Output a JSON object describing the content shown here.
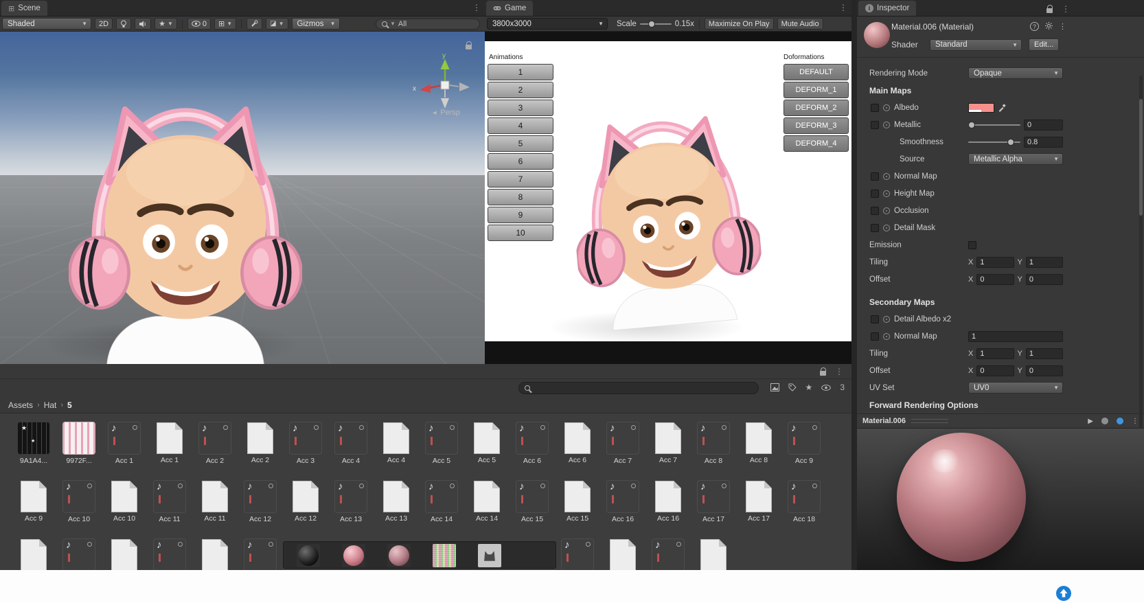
{
  "scene_view": {
    "tab_label": "Scene",
    "toolbar": {
      "draw_mode": "Shaded",
      "mode_2d_label": "2D",
      "visibility_count": "0",
      "gizmos_label": "Gizmos",
      "search_value": "All"
    },
    "gizmo": {
      "persp_label": "Persp",
      "axis_x_label": "x",
      "axis_y_label": "y"
    }
  },
  "game_view": {
    "tab_label": "Game",
    "toolbar": {
      "resolution": "3800x3000",
      "scale_label": "Scale",
      "scale_value": "0.15x",
      "maximize_label": "Maximize On Play",
      "mute_label": "Mute Audio"
    },
    "animations_title": "Animations",
    "animation_buttons": [
      "1",
      "2",
      "3",
      "4",
      "5",
      "6",
      "7",
      "8",
      "9",
      "10"
    ],
    "deformations_title": "Doformations",
    "deformation_buttons": [
      "DEFAULT",
      "DEFORM_1",
      "DEFORM_2",
      "DEFORM_3",
      "DEFORM_4"
    ]
  },
  "inspector": {
    "tab_label": "Inspector",
    "header": {
      "title": "Material.006 (Material)",
      "shader_label": "Shader",
      "shader_value": "Standard",
      "edit_button": "Edit..."
    },
    "rendering_mode": {
      "label": "Rendering Mode",
      "value": "Opaque"
    },
    "axis_labels": {
      "x": "X",
      "y": "Y"
    },
    "main_maps": {
      "section_label": "Main Maps",
      "albedo_label": "Albedo",
      "albedo_color": "#f5908c",
      "metallic_label": "Metallic",
      "metallic_value": "0",
      "smoothness_label": "Smoothness",
      "smoothness_value": "0.8",
      "source_label": "Source",
      "source_value": "Metallic Alpha",
      "normal_map_label": "Normal Map",
      "height_map_label": "Height Map",
      "occlusion_label": "Occlusion",
      "detail_mask_label": "Detail Mask",
      "emission_label": "Emission",
      "tiling_label": "Tiling",
      "offset_label": "Offset",
      "tiling_x": "1",
      "tiling_y": "1",
      "offset_x": "0",
      "offset_y": "0"
    },
    "secondary_maps": {
      "section_label": "Secondary Maps",
      "detail_albedo_label": "Detail Albedo x2",
      "normal_map_label": "Normal Map",
      "normal_map_value": "1",
      "tiling_label": "Tiling",
      "offset_label": "Offset",
      "tiling_x": "1",
      "tiling_y": "1",
      "offset_x": "0",
      "offset_y": "0",
      "uv_set_label": "UV Set",
      "uv_set_value": "UV0"
    },
    "forward_rendering_label": "Forward Rendering Options",
    "preview": {
      "title": "Material.006"
    }
  },
  "project": {
    "breadcrumb": {
      "root": "Assets",
      "folder": "Hat",
      "leaf": "5"
    },
    "hidden_count": "3",
    "asset_rows": [
      {
        "items": [
          {
            "label": "9A1A4...",
            "type": "tex-dark"
          },
          {
            "label": "9972F...",
            "type": "tex-pink"
          },
          {
            "label": "Acc 1",
            "type": "audio"
          },
          {
            "label": "Acc 1",
            "type": "doc"
          },
          {
            "label": "Acc 2",
            "type": "audio"
          },
          {
            "label": "Acc 2",
            "type": "doc"
          },
          {
            "label": "Acc 3",
            "type": "audio"
          },
          {
            "label": "Acc 4",
            "type": "audio"
          },
          {
            "label": "Acc 4",
            "type": "doc"
          },
          {
            "label": "Acc 5",
            "type": "audio"
          },
          {
            "label": "Acc 5",
            "type": "doc"
          },
          {
            "label": "Acc 6",
            "type": "audio"
          },
          {
            "label": "Acc 6",
            "type": "doc"
          },
          {
            "label": "Acc 7",
            "type": "audio"
          },
          {
            "label": "Acc 7",
            "type": "doc"
          },
          {
            "label": "Acc 8",
            "type": "audio"
          },
          {
            "label": "Acc 8",
            "type": "doc"
          },
          {
            "label": "Acc 9",
            "type": "audio"
          }
        ]
      },
      {
        "items": [
          {
            "label": "Acc 9",
            "type": "doc"
          },
          {
            "label": "Acc 10",
            "type": "audio"
          },
          {
            "label": "Acc 10",
            "type": "doc"
          },
          {
            "label": "Acc 11",
            "type": "audio"
          },
          {
            "label": "Acc 11",
            "type": "doc"
          },
          {
            "label": "Acc 12",
            "type": "audio"
          },
          {
            "label": "Acc 12",
            "type": "doc"
          },
          {
            "label": "Acc 13",
            "type": "audio"
          },
          {
            "label": "Acc 13",
            "type": "doc"
          },
          {
            "label": "Acc 14",
            "type": "audio"
          },
          {
            "label": "Acc 14",
            "type": "doc"
          },
          {
            "label": "Acc 15",
            "type": "audio"
          },
          {
            "label": "Acc 15",
            "type": "doc"
          },
          {
            "label": "Acc 16",
            "type": "audio"
          },
          {
            "label": "Acc 16",
            "type": "doc"
          },
          {
            "label": "Acc 17",
            "type": "audio"
          },
          {
            "label": "Acc 17",
            "type": "doc"
          },
          {
            "label": "Acc 18",
            "type": "audio"
          }
        ]
      },
      {
        "items": [
          {
            "label": "",
            "type": "doc"
          },
          {
            "label": "",
            "type": "audio"
          },
          {
            "label": "",
            "type": "doc"
          },
          {
            "label": "",
            "type": "audio"
          },
          {
            "label": "",
            "type": "doc"
          },
          {
            "label": "",
            "type": "audio"
          },
          {
            "label": "",
            "type": "spacer"
          },
          {
            "label": "",
            "type": "spacer"
          },
          {
            "label": "",
            "type": "spacer"
          },
          {
            "label": "",
            "type": "spacer"
          },
          {
            "label": "",
            "type": "spacer"
          },
          {
            "label": "",
            "type": "spacer"
          },
          {
            "label": "",
            "type": "audio"
          },
          {
            "label": "",
            "type": "doc"
          },
          {
            "label": "",
            "type": "audio"
          },
          {
            "label": "",
            "type": "doc"
          }
        ]
      }
    ],
    "material_strip": [
      {
        "name": "sphere-black"
      },
      {
        "name": "sphere-rose"
      },
      {
        "name": "sphere-mauve"
      },
      {
        "name": "texture-noise"
      },
      {
        "name": "texture-cat"
      }
    ]
  }
}
